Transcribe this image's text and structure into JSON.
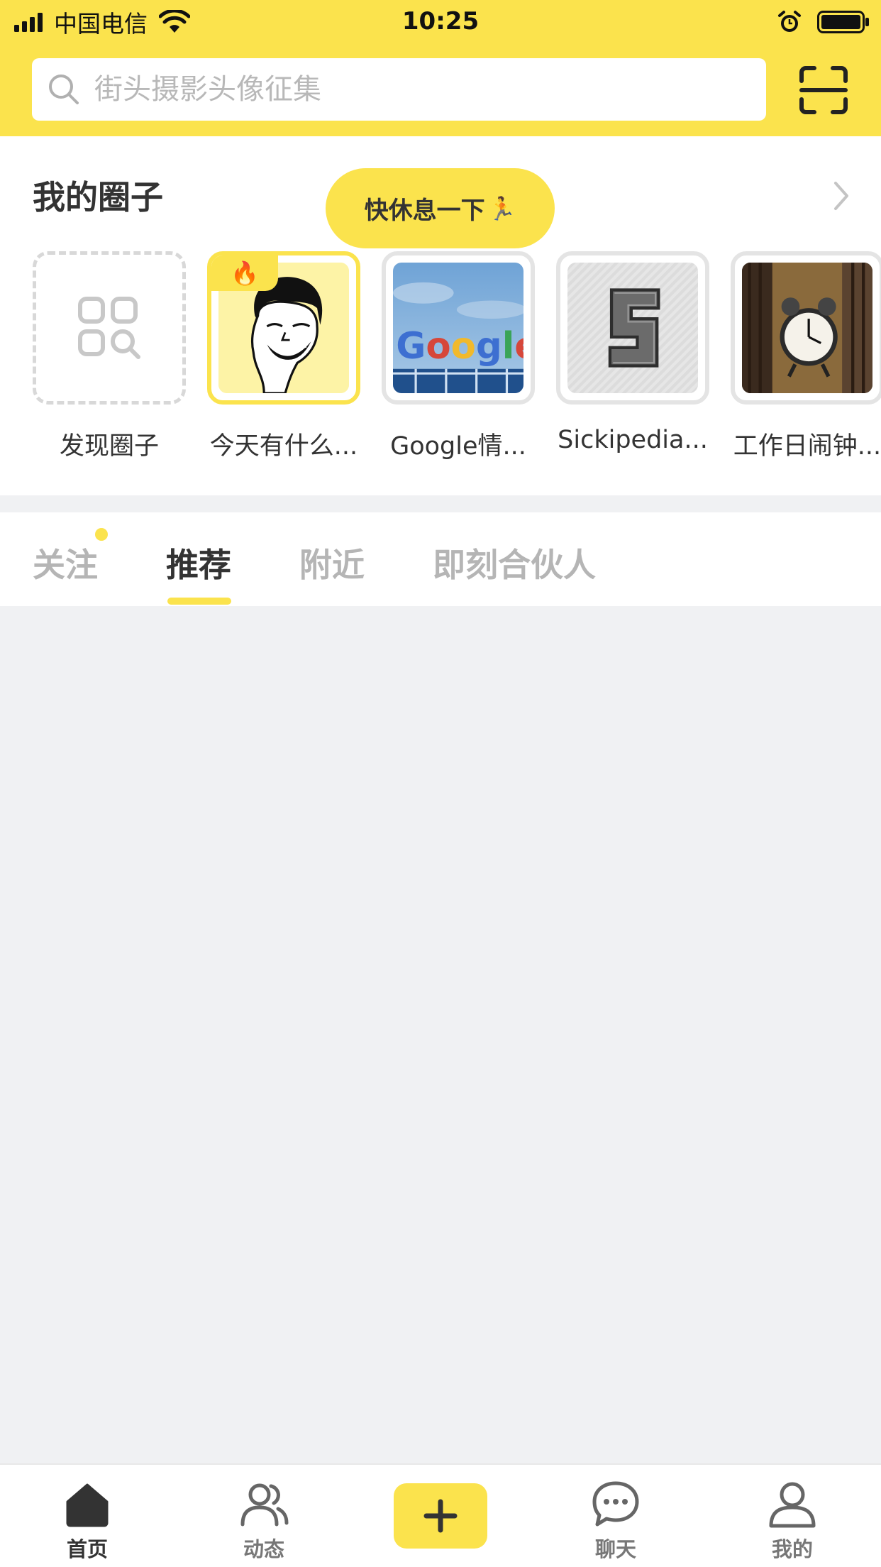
{
  "status_bar": {
    "carrier": "中国电信",
    "time": "10:25"
  },
  "search": {
    "placeholder": "街头摄影头像征集"
  },
  "circles": {
    "title": "我的圈子",
    "tooltip": "快休息一下",
    "tooltip_emoji": "🏃",
    "items": [
      {
        "label": "发现圈子"
      },
      {
        "label": "今天有什么..."
      },
      {
        "label": "Google情..."
      },
      {
        "label": "Sickipedia..."
      },
      {
        "label": "工作日闹钟..."
      }
    ],
    "hot_badge": "🔥"
  },
  "tabs": [
    {
      "label": "关注"
    },
    {
      "label": "推荐"
    },
    {
      "label": "附近"
    },
    {
      "label": "即刻合伙人"
    }
  ],
  "bottom_nav": [
    {
      "label": "首页"
    },
    {
      "label": "动态"
    },
    {
      "label": "聊天"
    },
    {
      "label": "我的"
    }
  ],
  "colors": {
    "accent": "#fbe34d",
    "background": "#f0f1f3"
  }
}
